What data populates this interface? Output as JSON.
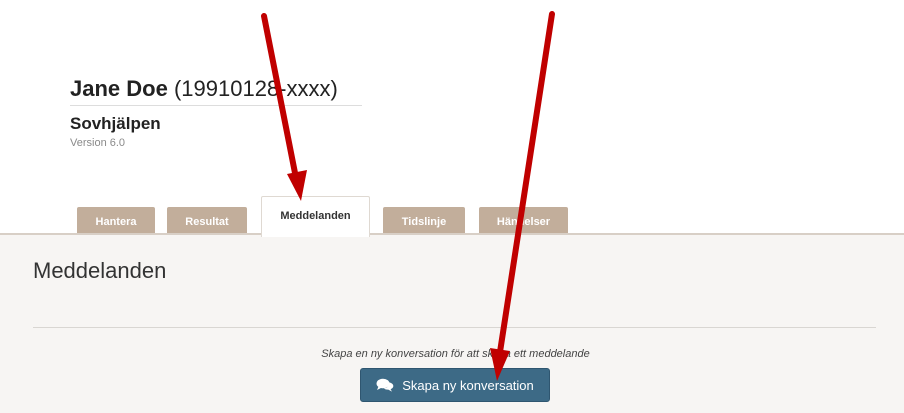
{
  "patient": {
    "name": "Jane Doe",
    "id": "(19910128-xxxx)"
  },
  "program": {
    "name": "Sovhjälpen",
    "version": "Version 6.0"
  },
  "tabs": [
    {
      "label": "Hantera",
      "active": false
    },
    {
      "label": "Resultat",
      "active": false
    },
    {
      "label": "Meddelanden",
      "active": true
    },
    {
      "label": "Tidslinje",
      "active": false
    },
    {
      "label": "Händelser",
      "active": false
    }
  ],
  "messages": {
    "title": "Meddelanden",
    "empty_hint": "Skapa en ny konversation för att skriva ett meddelande",
    "new_button_label": "Skapa ny konversation",
    "new_button_icon": "comments-icon"
  },
  "annotation": {
    "arrow_color": "#c00000",
    "arrow_count": 2
  },
  "colors": {
    "tab_inactive": "#c2ae9b",
    "content_bg": "#f7f5f3",
    "button_bg": "#3d6a86"
  }
}
